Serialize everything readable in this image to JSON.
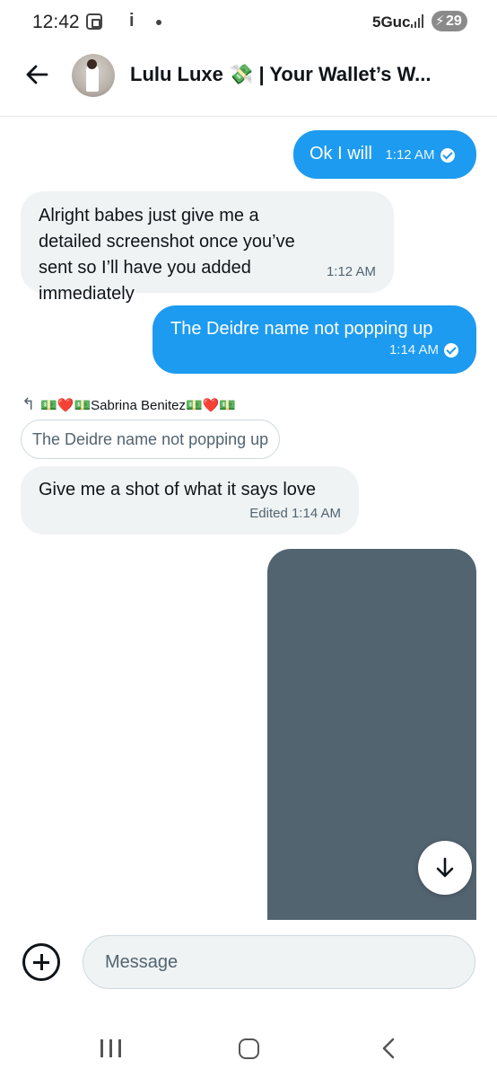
{
  "status_bar": {
    "time": "12:42",
    "network": "5Guc",
    "battery": "29"
  },
  "header": {
    "title": "Lulu Luxe 💸 | Your Wallet’s W..."
  },
  "messages": [
    {
      "direction": "outgoing",
      "text": "Ok I will",
      "time": "1:12 AM",
      "seen": true
    },
    {
      "direction": "incoming",
      "text": "Alright babes just give me a detailed screenshot once you’ve sent so I’ll have you added immediately",
      "time": "1:12 AM"
    },
    {
      "direction": "outgoing",
      "text": "The Deidre name not popping up",
      "time": "1:14 AM",
      "seen": true
    },
    {
      "direction": "incoming",
      "reply_to": {
        "author": "💵❤️💵Sabrina Benitez💵❤️💵",
        "text": "The Deidre name not popping up"
      },
      "text": "Give me a shot of what it says love",
      "time": "Edited 1:14 AM"
    },
    {
      "direction": "outgoing",
      "type": "media"
    }
  ],
  "composer": {
    "placeholder": "Message"
  },
  "colors": {
    "accent": "#1d9bf0",
    "incoming_bubble": "#eff3f4",
    "media_placeholder": "#536471"
  }
}
